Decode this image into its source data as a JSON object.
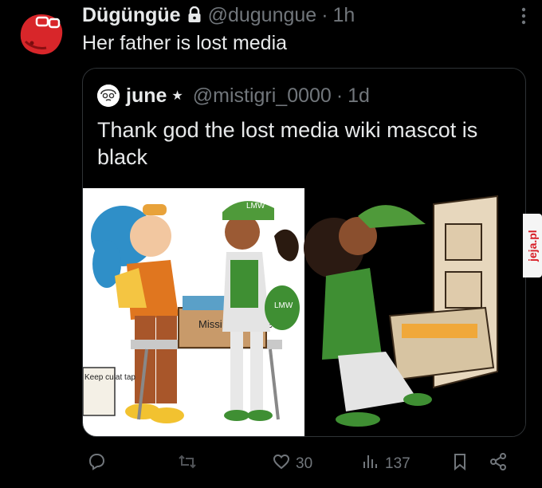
{
  "tweet": {
    "display_name": "Dügüngüe",
    "handle": "@dugungue",
    "separator": "·",
    "time": "1h",
    "text": "Her father is lost media"
  },
  "quoted": {
    "display_name": "june",
    "star": "★",
    "handle": "@mistigri_0000",
    "separator": "·",
    "time": "1d",
    "text": "Thank god the lost media wiki mascot is black",
    "image_left_sign": "Missing episode",
    "image_left_cap": "LMW",
    "image_left_bag": "LMW",
    "image_left_sign_small": "Keep culat tap"
  },
  "actions": {
    "likes": "30",
    "views": "137"
  },
  "watermark": "jeja.pl",
  "icons": [
    "lock-icon",
    "more-icon",
    "reply-icon",
    "retweet-icon",
    "like-icon",
    "views-icon",
    "bookmark-icon",
    "share-icon"
  ]
}
